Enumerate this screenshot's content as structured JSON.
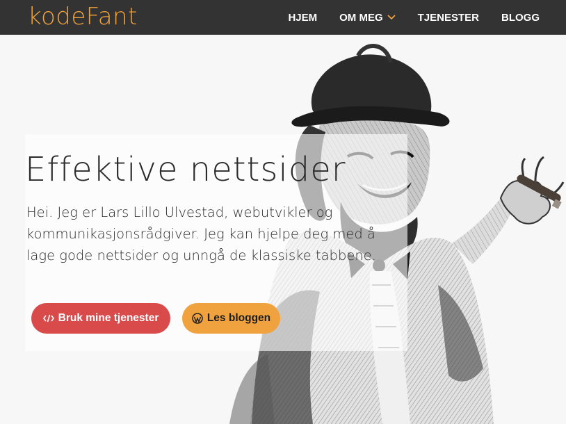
{
  "brand": {
    "logo_text": "kodeFant",
    "accent_color": "#f0a23e"
  },
  "nav": {
    "items": [
      {
        "label": "HJEM"
      },
      {
        "label": "OM MEG",
        "has_dropdown": true
      },
      {
        "label": "TJENESTER"
      },
      {
        "label": "BLOGG"
      }
    ]
  },
  "hero": {
    "title": "Effektive nettsider",
    "intro": "Hei. Jeg er Lars Lillo Ulvestad, webutvikler og kommunikasjonsrådgiver. Jeg kan hjelpe deg med å lage gode nettsider og unngå de klassiske tabbene.",
    "primary_button": {
      "label": "Bruk mine tjenester",
      "icon": "code-icon",
      "color": "#d94b4b"
    },
    "secondary_button": {
      "label": "Les bloggen",
      "icon": "wordpress-icon",
      "color": "#f0a23e"
    },
    "image": "illustration of a laughing vagabond man in a hat holding a cigar"
  }
}
